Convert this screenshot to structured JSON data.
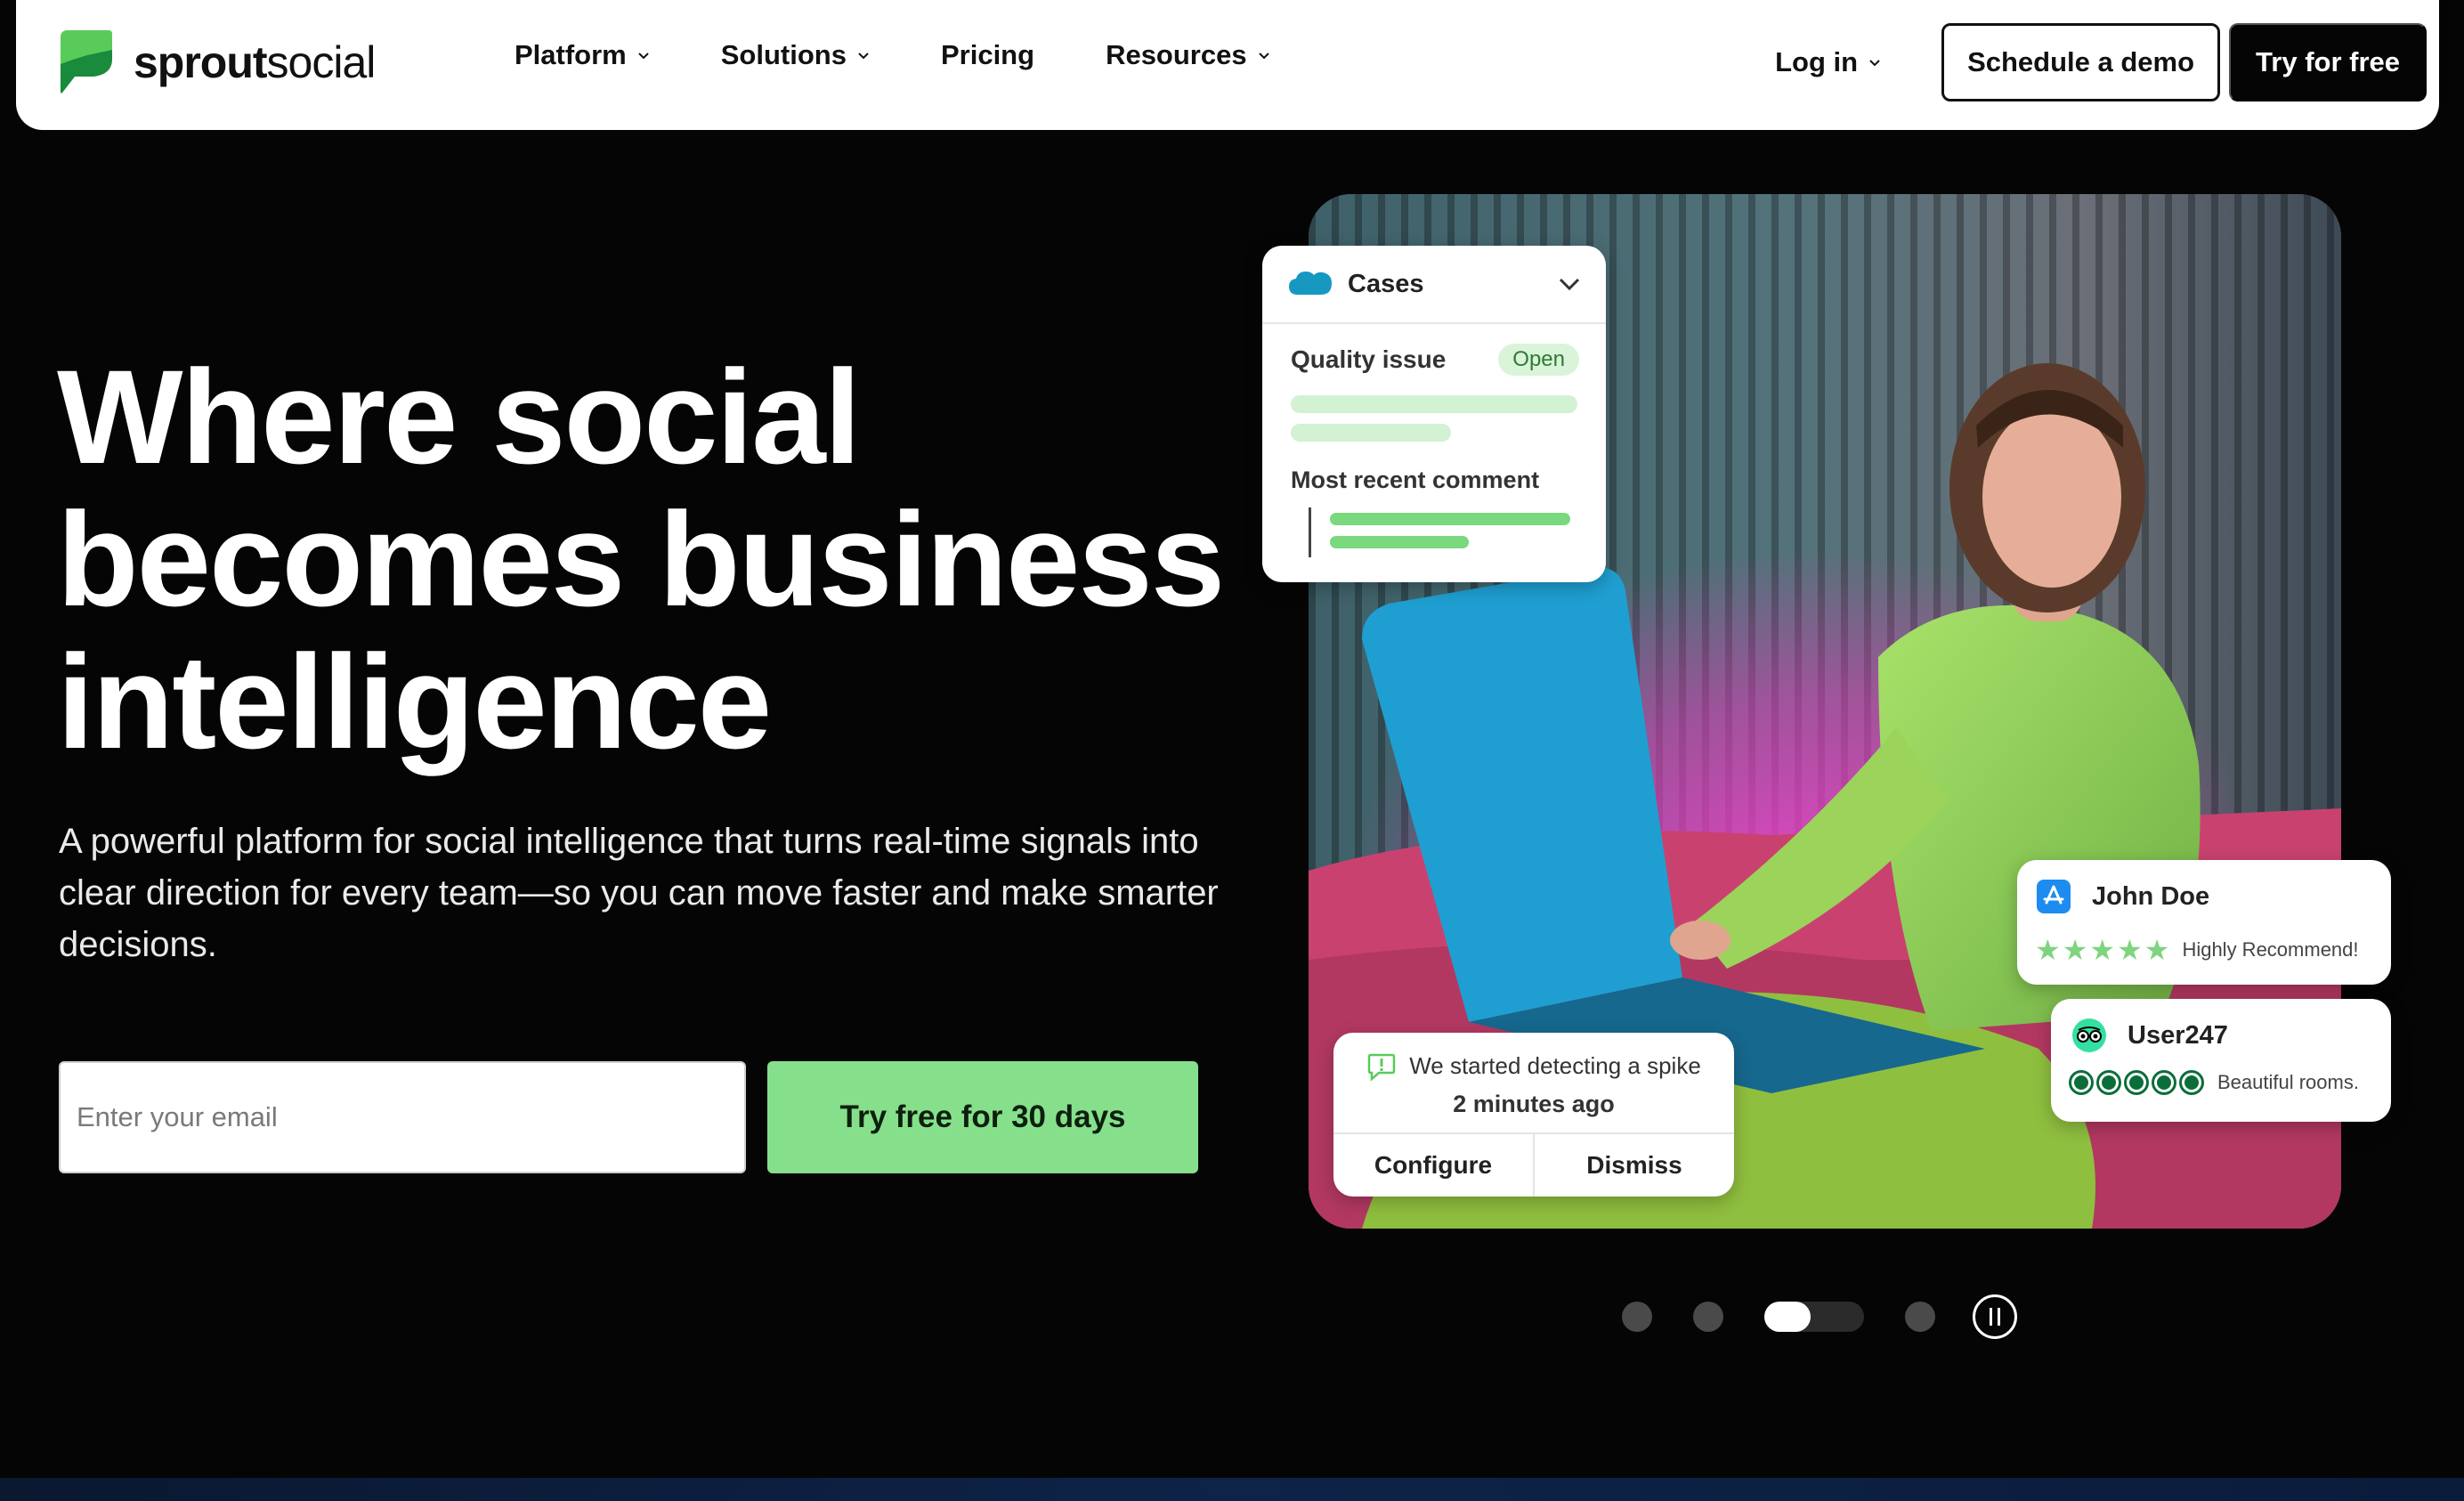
{
  "brand": {
    "name_bold": "sprout",
    "name_light": "social",
    "logo_color": "#59cb59"
  },
  "nav": {
    "items": [
      {
        "label": "Platform",
        "has_dropdown": true
      },
      {
        "label": "Solutions",
        "has_dropdown": true
      },
      {
        "label": "Pricing",
        "has_dropdown": false
      },
      {
        "label": "Resources",
        "has_dropdown": true
      }
    ],
    "login_label": "Log in",
    "demo_label": "Schedule a demo",
    "try_label": "Try for free"
  },
  "hero": {
    "title_lines": [
      "Where social",
      "becomes business",
      "intelligence"
    ],
    "subtitle": "A powerful platform for social intelligence that turns real-time signals into clear direction for every team—so you can move faster and make smarter decisions.",
    "email_placeholder": "Enter your email",
    "cta_label": "Try free for 30 days",
    "cta_color": "#86e08b"
  },
  "cards": {
    "cases": {
      "title": "Cases",
      "issue": "Quality issue",
      "status": "Open",
      "recent_label": "Most recent comment",
      "icon": "salesforce-icon"
    },
    "spike": {
      "line1": "We started detecting a spike",
      "line2": "2 minutes ago",
      "configure_label": "Configure",
      "dismiss_label": "Dismiss",
      "icon": "alert-chat-icon"
    },
    "review_john": {
      "name": "John Doe",
      "stars": 5,
      "text": "Highly Recommend!",
      "icon": "app-store-icon"
    },
    "review_user": {
      "name": "User247",
      "bubbles": 5,
      "text": "Beautiful rooms.",
      "icon": "tripadvisor-icon"
    }
  },
  "carousel": {
    "slides": 4,
    "active_slide": 3,
    "pause_icon": "pause-icon"
  }
}
